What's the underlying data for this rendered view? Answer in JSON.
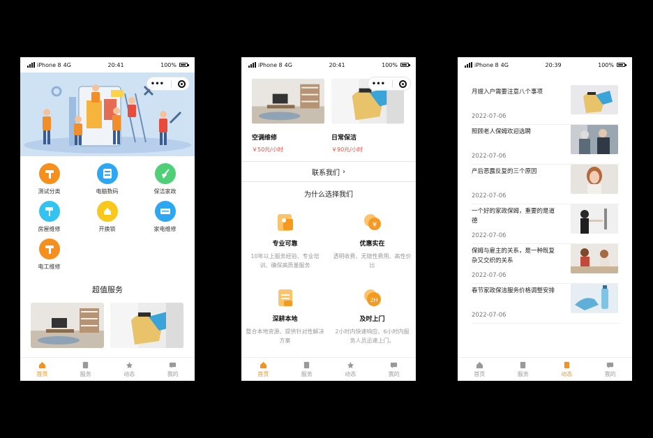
{
  "colors": {
    "accent": "#f5911e",
    "price": "#e54d42",
    "banner_bg": "#c9ddf2"
  },
  "status": {
    "carrier": "iPhone 8",
    "network": "4G",
    "battery": "100%",
    "times": [
      "20:41",
      "20:41",
      "20:39"
    ]
  },
  "capsule": {
    "more": "•••"
  },
  "tabs": [
    "首页",
    "服务",
    "动态",
    "我的"
  ],
  "home": {
    "categories": [
      {
        "label": "测试分类",
        "color": "#f5901f",
        "icon": "hammer-icon"
      },
      {
        "label": "电脑数码",
        "color": "#2ea7f2",
        "icon": "computer-icon"
      },
      {
        "label": "保洁家政",
        "color": "#4fcf78",
        "icon": "broom-icon"
      },
      {
        "label": "房屋维修",
        "color": "#34c3f0",
        "icon": "paint-roller-icon"
      },
      {
        "label": "开换锁",
        "color": "#f8c81d",
        "icon": "lock-icon"
      },
      {
        "label": "家电维修",
        "color": "#2ea7f2",
        "icon": "appliance-icon"
      },
      {
        "label": "电工维修",
        "color": "#f5901f",
        "icon": "electric-icon"
      }
    ],
    "section_title": "超值服务"
  },
  "service": {
    "cards": [
      {
        "name": "空调维修",
        "price": "￥50元/小时"
      },
      {
        "name": "日常保洁",
        "price": "￥90元/小时"
      }
    ],
    "contact_label": "联系我们",
    "why_title": "为什么选择我们",
    "features": [
      {
        "title": "专业可靠",
        "desc": "10年以上服务经验、专业培训、确保高质量服务",
        "color": "#f8a52a",
        "icon": "badge-icon"
      },
      {
        "title": "优惠实在",
        "desc": "透明收费、无隐性费用、高性价比",
        "color": "#f59a1f",
        "icon": "coin-icon"
      },
      {
        "title": "深耕本地",
        "desc": "整合本地资源、提供针对性解决方案",
        "color": "#f8a52a",
        "icon": "document-icon"
      },
      {
        "title": "及时上门",
        "desc": "2小时内快速响应、6小时内服务人员迅速上门。",
        "color": "#f59a1f",
        "icon": "clock-icon"
      }
    ]
  },
  "news": {
    "items": [
      {
        "title": "月嫂入户需要注意八个事项",
        "date": "2022-07-06"
      },
      {
        "title": "照顾老人保姆欢迎选聘",
        "date": "2022-07-06"
      },
      {
        "title": "产后恶露反复的三个原因",
        "date": "2022-07-06"
      },
      {
        "title": "一个好的家政保姆，重要的是道德",
        "date": "2022-07-06"
      },
      {
        "title": "保姆与雇主的关系，是一种既复杂又交织的关系",
        "date": "2022-07-06"
      },
      {
        "title": "春节家政保洁服务价格调整安排",
        "date": "2022-07-06"
      }
    ]
  }
}
